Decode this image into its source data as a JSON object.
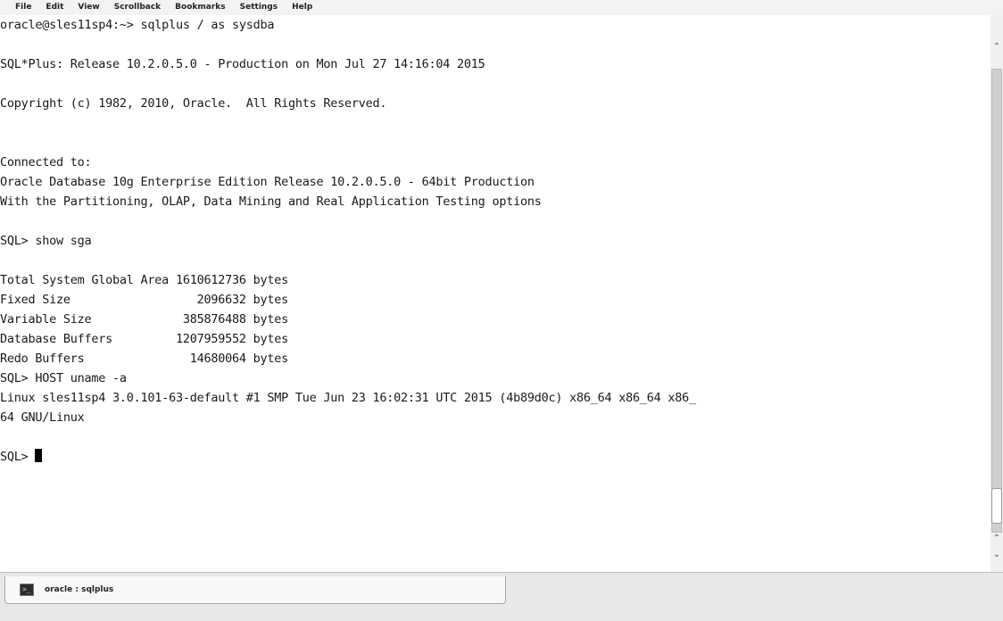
{
  "menu": [
    "File",
    "Edit",
    "View",
    "Scrollback",
    "Bookmarks",
    "Settings",
    "Help"
  ],
  "terminal": {
    "lines": [
      "oracle@sles11sp4:~> sqlplus / as sysdba",
      "",
      "SQL*Plus: Release 10.2.0.5.0 - Production on Mon Jul 27 14:16:04 2015",
      "",
      "Copyright (c) 1982, 2010, Oracle.  All Rights Reserved.",
      "",
      "",
      "Connected to:",
      "Oracle Database 10g Enterprise Edition Release 10.2.0.5.0 - 64bit Production",
      "With the Partitioning, OLAP, Data Mining and Real Application Testing options",
      "",
      "SQL> show sga",
      "",
      "Total System Global Area 1610612736 bytes",
      "Fixed Size                  2096632 bytes",
      "Variable Size             385876488 bytes",
      "Database Buffers         1207959552 bytes",
      "Redo Buffers               14680064 bytes",
      "SQL> HOST uname -a",
      "Linux sles11sp4 3.0.101-63-default #1 SMP Tue Jun 23 16:02:31 UTC 2015 (4b89d0c) x86_64 x86_64 x86_",
      "64 GNU/Linux",
      ""
    ],
    "prompt": "SQL> "
  },
  "tab": {
    "icon": "terminal-icon",
    "icon_glyph": ">_",
    "label": "oracle : sqlplus"
  },
  "scrollbar": {
    "up_glyph": "⌃",
    "down_glyph": "⌄"
  }
}
